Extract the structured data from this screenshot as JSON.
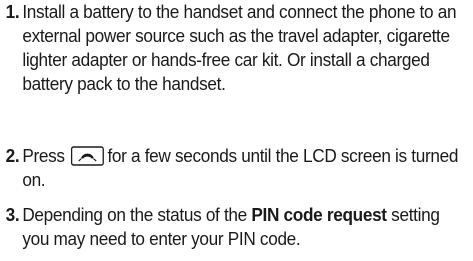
{
  "steps": [
    {
      "number": "1.",
      "text": "Install a battery to the handset and connect the phone to an external power source such as the travel adapter, cigarette lighter adapter or hands-free car kit. Or install a charged battery pack to the handset."
    },
    {
      "number": "2.",
      "text_before": "Press",
      "icon": "power-key-icon",
      "text_after": "for a few seconds until the LCD screen is turned on."
    },
    {
      "number": "3.",
      "text_before": "Depending on the status of the",
      "bold": "PIN code request",
      "text_after": "setting you may need to enter your PIN code."
    }
  ]
}
